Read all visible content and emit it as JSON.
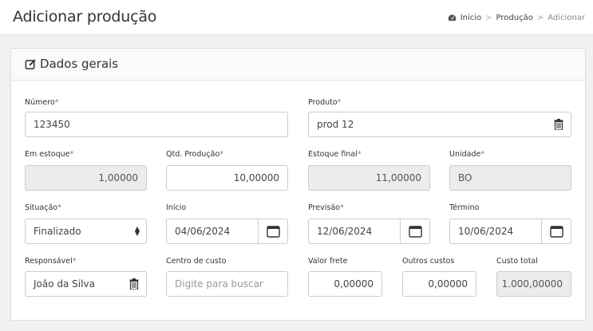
{
  "header": {
    "title": "Adicionar produção",
    "breadcrumb": {
      "home": "Início",
      "section": "Produção",
      "current": "Adicionar",
      "separator": ">"
    }
  },
  "card": {
    "title": "Dados gerais"
  },
  "required_mark": "*",
  "form": {
    "numero": {
      "label": "Número",
      "value": "123450"
    },
    "produto": {
      "label": "Produto",
      "value": "prod 12"
    },
    "em_estoque": {
      "label": "Em estoque",
      "value": "1,00000"
    },
    "qtd_producao": {
      "label": "Qtd. Produção",
      "value": "10,00000"
    },
    "estoque_final": {
      "label": "Estoque final",
      "value": "11,00000"
    },
    "unidade": {
      "label": "Unidade",
      "value": "BO"
    },
    "situacao": {
      "label": "Situação",
      "value": "Finalizado"
    },
    "inicio": {
      "label": "Início",
      "value": "04/06/2024"
    },
    "previsao": {
      "label": "Previsão",
      "value": "12/06/2024"
    },
    "termino": {
      "label": "Término",
      "value": "10/06/2024"
    },
    "responsavel": {
      "label": "Responsável",
      "value": "João da Silva"
    },
    "centro_custo": {
      "label": "Centro de custo",
      "placeholder": "Digite para buscar"
    },
    "valor_frete": {
      "label": "Valor frete",
      "value": "0,00000"
    },
    "outros_custos": {
      "label": "Outros custos",
      "value": "0,00000"
    },
    "custo_total": {
      "label": "Custo total",
      "value": "1.000,00000"
    }
  },
  "colors": {
    "required": "#d9534f",
    "readonly_bg": "#eaeced",
    "border": "#cccccc"
  },
  "icons": [
    "dashboard-icon",
    "edit-icon",
    "trash-icon",
    "calendar-icon",
    "select-arrows-icon"
  ]
}
